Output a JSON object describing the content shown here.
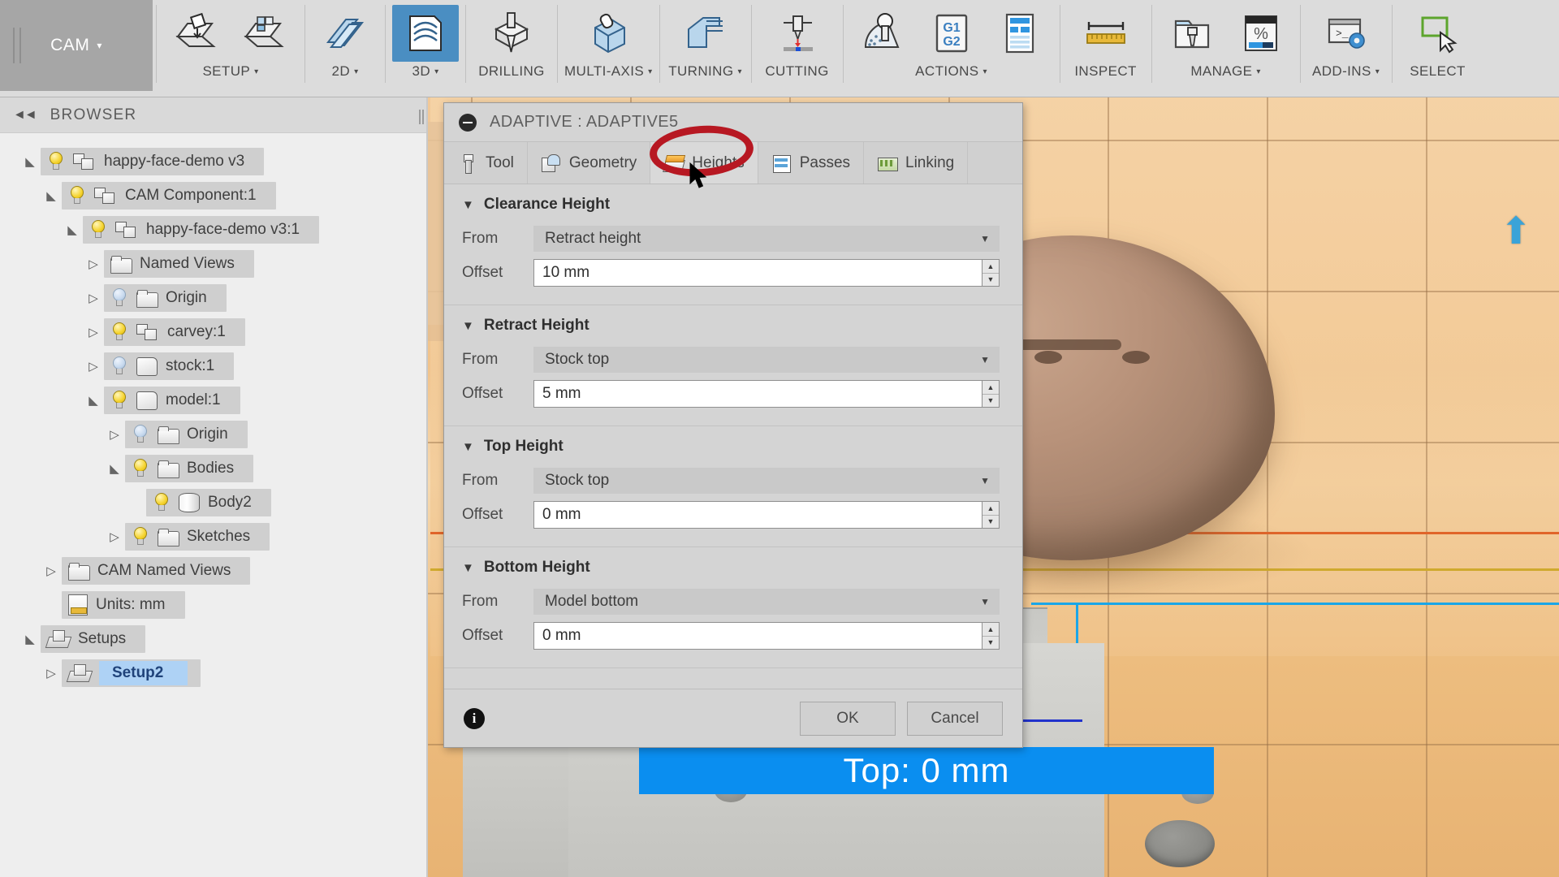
{
  "ribbon": {
    "workspace": {
      "label": "CAM",
      "caret": "▾"
    },
    "groups": [
      {
        "name": "setup",
        "label": "SETUP",
        "caret": "▾",
        "items": [
          {
            "icon": "new-setup-icon"
          },
          {
            "icon": "folder-setup-icon"
          }
        ]
      },
      {
        "name": "2d",
        "label": "2D",
        "caret": "▾",
        "items": [
          {
            "icon": "2d-toolpath-icon"
          }
        ]
      },
      {
        "name": "3d",
        "label": "3D",
        "caret": "▾",
        "active": true,
        "items": [
          {
            "icon": "3d-toolpath-icon"
          }
        ]
      },
      {
        "name": "drilling",
        "label": "DRILLING",
        "caret": "",
        "items": [
          {
            "icon": "drill-icon"
          }
        ]
      },
      {
        "name": "multi-axis",
        "label": "MULTI-AXIS",
        "caret": "▾",
        "items": [
          {
            "icon": "multi-axis-icon"
          }
        ]
      },
      {
        "name": "turning",
        "label": "TURNING",
        "caret": "▾",
        "items": [
          {
            "icon": "turning-icon"
          }
        ]
      },
      {
        "name": "cutting",
        "label": "CUTTING",
        "caret": "",
        "items": [
          {
            "icon": "cutting-icon"
          }
        ]
      },
      {
        "name": "actions",
        "label": "ACTIONS",
        "caret": "▾",
        "items": [
          {
            "icon": "simulate-icon"
          },
          {
            "icon": "g1-g2-post-process-icon",
            "text1": "G1",
            "text2": "G2"
          },
          {
            "icon": "setup-sheet-icon"
          }
        ]
      },
      {
        "name": "inspect",
        "label": "INSPECT",
        "caret": "",
        "items": [
          {
            "icon": "measure-ruler-icon"
          }
        ]
      },
      {
        "name": "manage",
        "label": "MANAGE",
        "caret": "▾",
        "items": [
          {
            "icon": "tool-library-icon"
          },
          {
            "icon": "machining-time-percent-icon",
            "text1": "%"
          }
        ]
      },
      {
        "name": "add-ins",
        "label": "ADD-INS",
        "caret": "▾",
        "items": [
          {
            "icon": "script-console-icon"
          }
        ]
      },
      {
        "name": "select",
        "label": "SELECT",
        "caret": "",
        "items": [
          {
            "icon": "select-cursor-icon"
          }
        ]
      }
    ]
  },
  "browser": {
    "title": "BROWSER",
    "collapse_icon": "collapse-left-icon",
    "tree": [
      {
        "indent": 0,
        "arrow": "open",
        "bulb": "on",
        "icon": "component-icon",
        "label": "happy-face-demo v3"
      },
      {
        "indent": 1,
        "arrow": "open",
        "bulb": "on",
        "icon": "component-icon",
        "label": "CAM Component:1"
      },
      {
        "indent": 2,
        "arrow": "open",
        "bulb": "on",
        "icon": "component-icon",
        "label": "happy-face-demo v3:1"
      },
      {
        "indent": 3,
        "arrow": "closed",
        "bulb": "none",
        "icon": "folder-icon",
        "label": "Named Views"
      },
      {
        "indent": 3,
        "arrow": "closed",
        "bulb": "off",
        "icon": "folder-icon",
        "label": "Origin"
      },
      {
        "indent": 3,
        "arrow": "closed",
        "bulb": "on",
        "icon": "component-icon",
        "label": "carvey:1"
      },
      {
        "indent": 3,
        "arrow": "closed",
        "bulb": "off",
        "icon": "box-body-icon",
        "label": "stock:1"
      },
      {
        "indent": 3,
        "arrow": "open",
        "bulb": "on",
        "icon": "box-body-icon",
        "label": "model:1"
      },
      {
        "indent": 4,
        "arrow": "closed",
        "bulb": "off",
        "icon": "folder-icon",
        "label": "Origin"
      },
      {
        "indent": 4,
        "arrow": "open",
        "bulb": "on",
        "icon": "folder-icon",
        "label": "Bodies"
      },
      {
        "indent": 5,
        "arrow": "none",
        "bulb": "on",
        "icon": "cylinder-body-icon",
        "label": "Body2"
      },
      {
        "indent": 4,
        "arrow": "closed",
        "bulb": "on",
        "icon": "folder-icon",
        "label": "Sketches"
      },
      {
        "indent": 1,
        "arrow": "closed",
        "bulb": "none",
        "icon": "folder-icon",
        "label": "CAM Named Views"
      },
      {
        "indent": 1,
        "arrow": "none",
        "bulb": "none",
        "icon": "units-doc-icon",
        "label": "Units: mm"
      },
      {
        "indent": 0,
        "arrow": "open",
        "bulb": "none",
        "icon": "setup-folder-icon",
        "label": "Setups"
      },
      {
        "indent": 1,
        "arrow": "closed",
        "bulb": "none",
        "icon": "setup-folder-icon",
        "label": "Setup2",
        "selected": true
      }
    ]
  },
  "dialog": {
    "title": "ADAPTIVE : ADAPTIVE5",
    "collapse_icon": "minimize-icon",
    "tabs": [
      {
        "id": "tool",
        "label": "Tool",
        "icon": "tool-icon",
        "active": false
      },
      {
        "id": "geometry",
        "label": "Geometry",
        "icon": "geometry-icon",
        "active": false
      },
      {
        "id": "heights",
        "label": "Heights",
        "icon": "heights-icon",
        "active": true
      },
      {
        "id": "passes",
        "label": "Passes",
        "icon": "passes-icon",
        "active": false
      },
      {
        "id": "linking",
        "label": "Linking",
        "icon": "linking-icon",
        "active": false
      }
    ],
    "sections": [
      {
        "id": "clearance-height",
        "title": "Clearance Height",
        "expanded": true,
        "from_label": "From",
        "from_value": "Retract height",
        "offset_label": "Offset",
        "offset_value": "10 mm"
      },
      {
        "id": "retract-height",
        "title": "Retract Height",
        "expanded": true,
        "from_label": "From",
        "from_value": "Stock top",
        "offset_label": "Offset",
        "offset_value": "5 mm"
      },
      {
        "id": "top-height",
        "title": "Top Height",
        "expanded": true,
        "from_label": "From",
        "from_value": "Stock top",
        "offset_label": "Offset",
        "offset_value": "0 mm"
      },
      {
        "id": "bottom-height",
        "title": "Bottom Height",
        "expanded": true,
        "from_label": "From",
        "from_value": "Model bottom",
        "offset_label": "Offset",
        "offset_value": "0 mm"
      }
    ],
    "footer": {
      "info_icon": "info-icon",
      "ok_label": "OK",
      "cancel_label": "Cancel"
    }
  },
  "viewport": {
    "manipulator_banner": "Top: 0 mm",
    "view_arrow_icon": "view-up-arrow-icon",
    "colors": {
      "banner_blue": "#0a8ef0",
      "annotation_red": "#b71822",
      "stock_tan": "#f0c490",
      "model_brown": "#b8927a"
    }
  },
  "annotation": {
    "shape": "red-ellipse-highlight",
    "target": "heights-tab"
  },
  "cursor": {
    "icon": "mouse-pointer-icon"
  }
}
